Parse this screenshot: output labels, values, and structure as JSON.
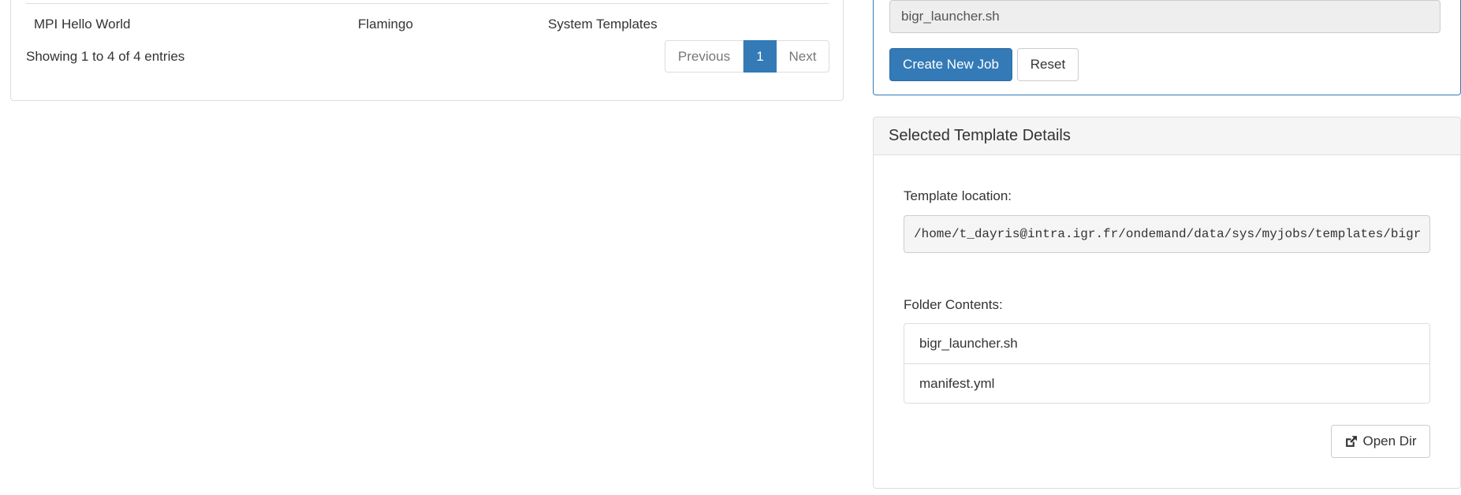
{
  "templates_table": {
    "last_row": {
      "name": "MPI Hello World",
      "host": "Flamingo",
      "source": "System Templates"
    },
    "info": "Showing 1 to 4 of 4 entries",
    "pagination": {
      "previous": "Previous",
      "current": "1",
      "next": "Next"
    }
  },
  "job_form": {
    "script_value": "bigr_launcher.sh",
    "create_button": "Create New Job",
    "reset_button": "Reset"
  },
  "template_details": {
    "heading": "Selected Template Details",
    "location_label": "Template location:",
    "location_value": "/home/t_dayris@intra.igr.fr/ondemand/data/sys/myjobs/templates/bigr",
    "folder_label": "Folder Contents:",
    "files": [
      "bigr_launcher.sh",
      "manifest.yml"
    ],
    "open_dir_button": "Open Dir",
    "open_dir_icon": "external-link-icon"
  },
  "colors": {
    "primary": "#337ab7",
    "border": "#dddddd",
    "panel_heading": "#f5f5f5"
  }
}
